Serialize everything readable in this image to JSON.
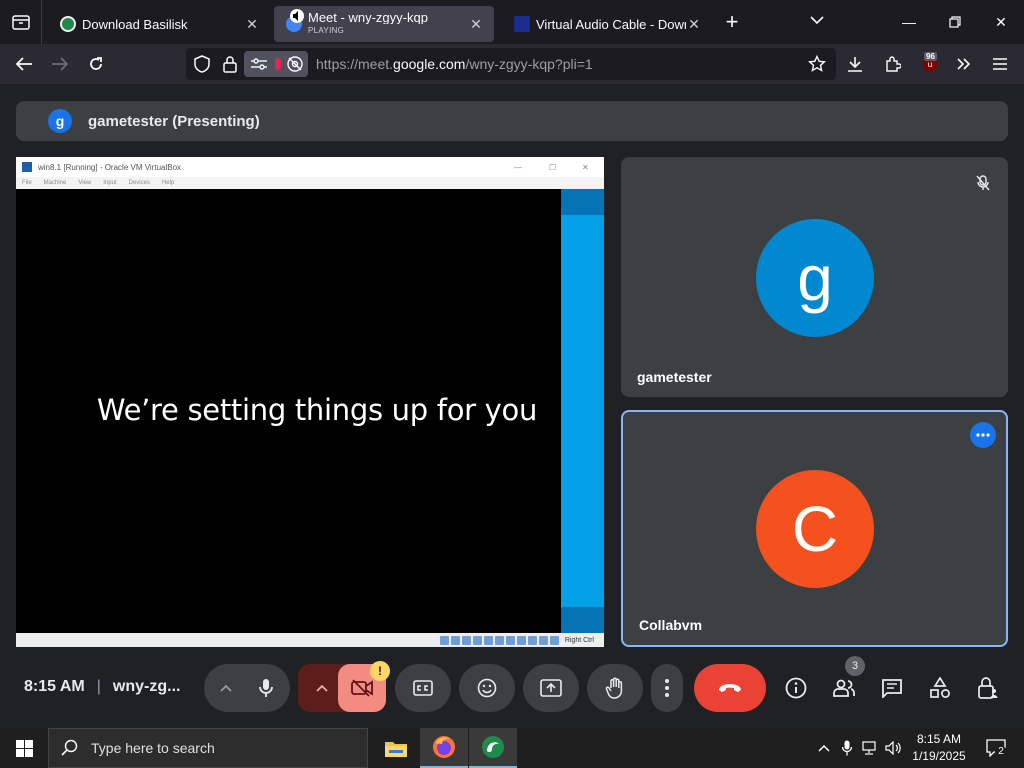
{
  "browser": {
    "tabs": [
      {
        "title": "Download Basilisk",
        "active": false
      },
      {
        "title": "Meet - wny-zgyy-kqp",
        "subtitle": "PLAYING",
        "active": true
      },
      {
        "title": "Virtual Audio Cable - Download",
        "active": false
      }
    ],
    "url": {
      "prefix": "https://meet.",
      "domain": "google.com",
      "path": "/wny-zgyy-kqp?pli=1"
    },
    "extension_badge": "96"
  },
  "meet": {
    "presenter": {
      "initial": "g",
      "label": "gametester (Presenting)"
    },
    "shared_screen": {
      "window_title": "win8.1 [Running] - Oracle VM VirtualBox",
      "menu": [
        "File",
        "Machine",
        "View",
        "Input",
        "Devices",
        "Help"
      ],
      "setup_text": "We’re setting things up for you",
      "host_key": "Right Ctrl"
    },
    "participants": [
      {
        "name": "gametester",
        "initial": "g",
        "color": "#0288d1",
        "muted": true
      },
      {
        "name": "Collabvm",
        "initial": "C",
        "color": "#f4511e",
        "muted": false
      }
    ],
    "time": "8:15 AM",
    "meeting_code": "wny-zg...",
    "notification_badge": "!",
    "participant_count": "3"
  },
  "taskbar": {
    "search_placeholder": "Type here to search",
    "time": "8:15 AM",
    "date": "1/19/2025",
    "notifications": "2"
  },
  "colors": {
    "meet_bg": "#202124",
    "tile_bg": "#3c4043",
    "end_call": "#ea4335",
    "accent_blue": "#8ab4f8",
    "camera_off": "#f28b82"
  }
}
